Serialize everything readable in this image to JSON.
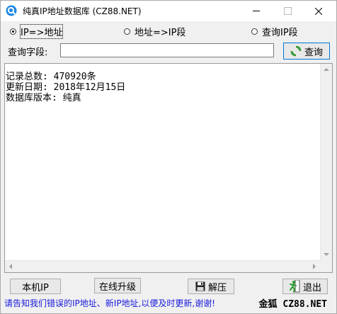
{
  "window": {
    "title": "纯真IP地址数据库  (CZ88.NET)"
  },
  "modes": [
    {
      "label": "IP=>地址",
      "checked": true
    },
    {
      "label": "地址=>IP段",
      "checked": false
    },
    {
      "label": "查询IP段",
      "checked": false
    }
  ],
  "query": {
    "label": "查询字段:",
    "value": "",
    "button_label": "查询"
  },
  "output": {
    "lines": "记录总数: 470920条\n更新日期: 2018年12月15日\n数据库版本: 纯真"
  },
  "buttons": {
    "local_ip": "本机IP",
    "online_update": "在线升级",
    "decompress": "解压",
    "exit": "退出"
  },
  "status": {
    "message": "请告知我们错误的IP地址、新IP地址,以便及时更新,谢谢!",
    "brand": "金狐 CZ88.NET"
  },
  "colors": {
    "status_text": "#1a1adc",
    "icon_blue": "#1e88e5",
    "icon_green": "#2e9a2e"
  }
}
